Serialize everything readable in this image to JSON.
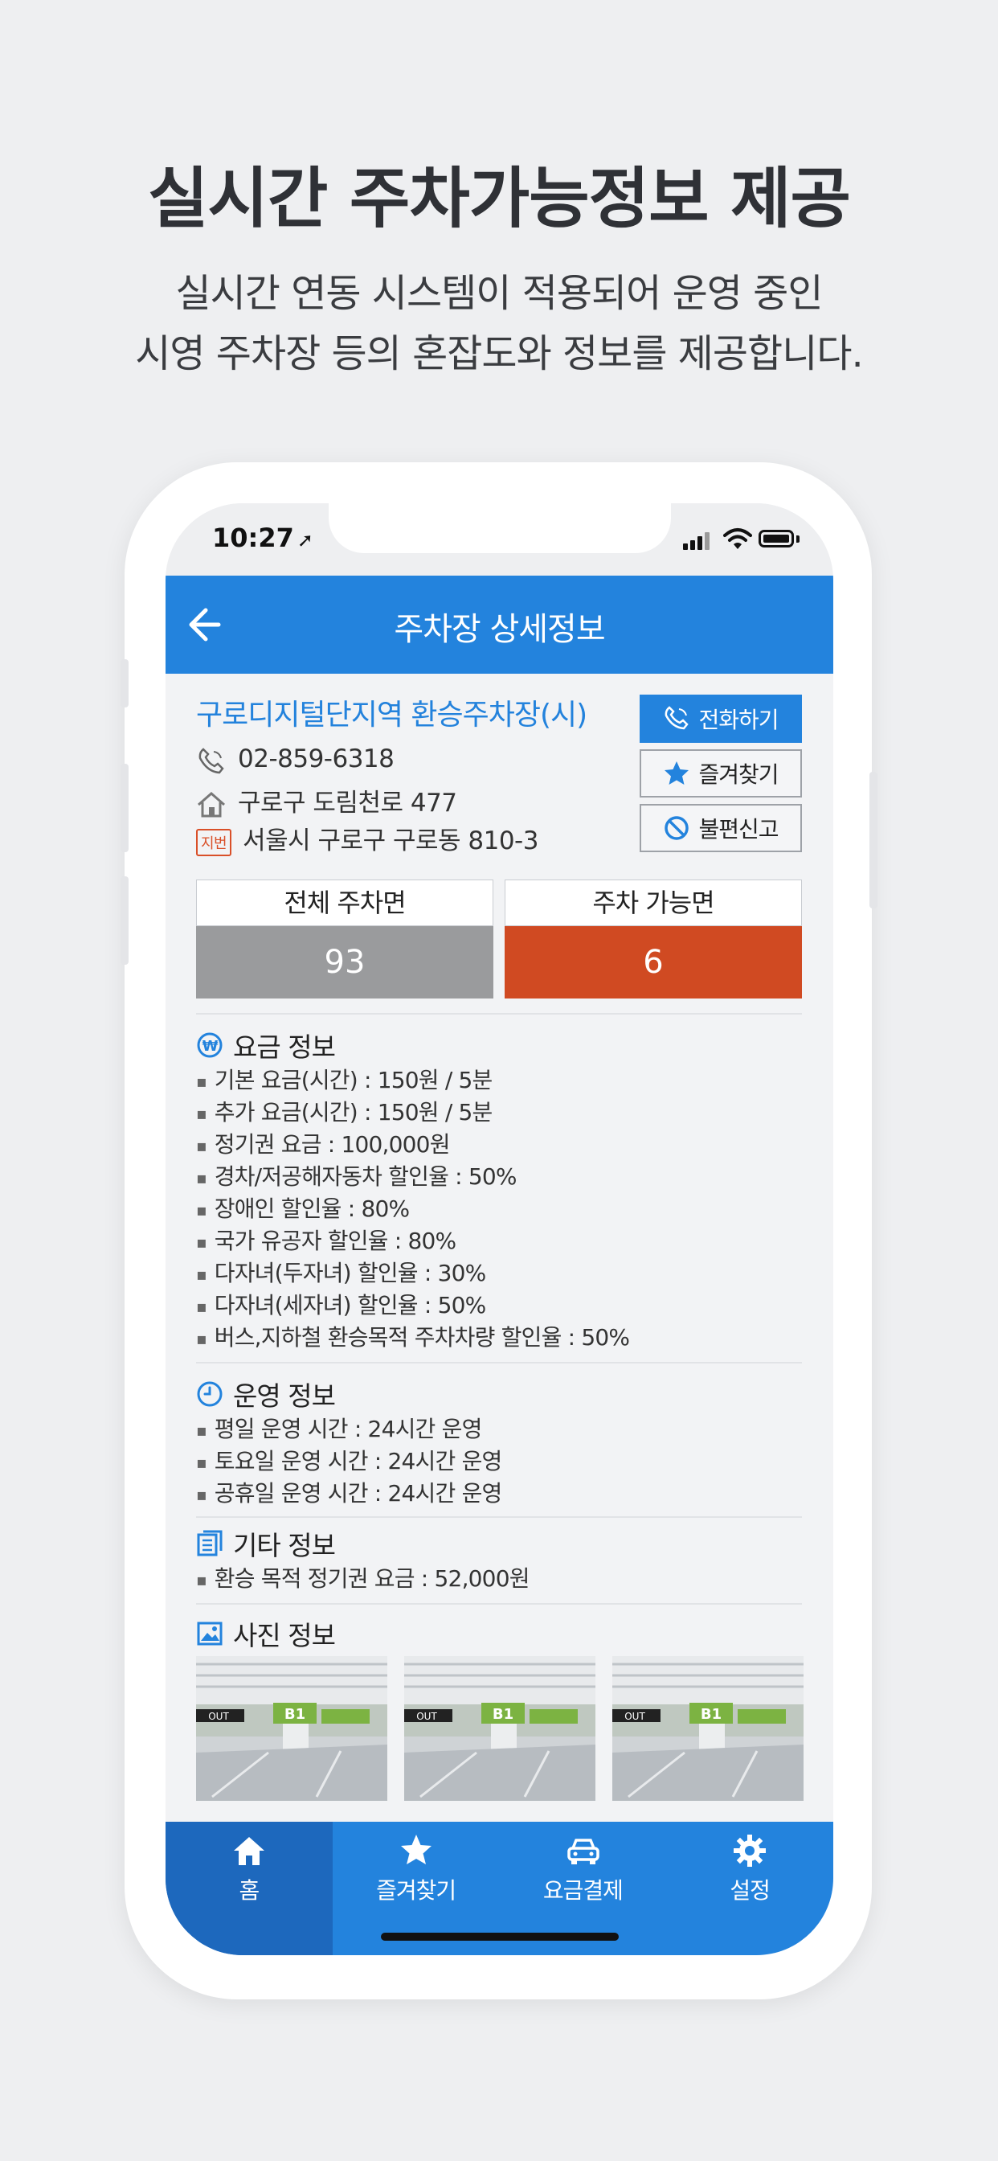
{
  "promo": {
    "headline": "실시간 주차가능정보 제공",
    "subline1": "실시간 연동 시스템이 적용되어 운영 중인",
    "subline2": "시영 주차장 등의 혼잡도와 정보를 제공합니다."
  },
  "status_bar": {
    "time": "10:27",
    "location_icon": "location-arrow-icon"
  },
  "appbar": {
    "title": "주차장 상세정보",
    "back_icon": "back-arrow-icon"
  },
  "lot": {
    "name": "구로디지털단지역 환승주차장(시)",
    "phone": "02-859-6318",
    "road_address": "구로구 도림천로 477",
    "jibun_badge": "지번",
    "jibun_address": "서울시 구로구 구로동 810-3"
  },
  "actions": {
    "call": "전화하기",
    "favorite": "즐겨찾기",
    "report": "불편신고"
  },
  "stats": {
    "total_label": "전체 주차면",
    "total_value": "93",
    "available_label": "주차 가능면",
    "available_value": "6",
    "colors": {
      "total": "#9a9b9d",
      "available": "#d04a22"
    }
  },
  "fee_info": {
    "title": "요금 정보",
    "items": [
      "기본 요금(시간) : 150원 / 5분",
      "추가 요금(시간) : 150원 / 5분",
      "정기권 요금 : 100,000원",
      "경차/저공해자동차 할인율 : 50%",
      "장애인 할인율 : 80%",
      "국가 유공자 할인율 : 80%",
      "다자녀(두자녀) 할인율 : 30%",
      "다자녀(세자녀) 할인율 : 50%",
      "버스,지하철 환승목적 주차차량 할인율 : 50%"
    ]
  },
  "operation_info": {
    "title": "운영 정보",
    "items": [
      "평일 운영 시간 : 24시간 운영",
      "토요일 운영 시간 : 24시간 운영",
      "공휴일 운영 시간 : 24시간 운영"
    ]
  },
  "other_info": {
    "title": "기타 정보",
    "items": [
      "환승 목적 정기권 요금 : 52,000원"
    ]
  },
  "photo_info": {
    "title": "사진 정보",
    "photos": [
      "parking-garage-photo",
      "parking-garage-photo",
      "parking-garage-photo"
    ]
  },
  "tabs": [
    {
      "label": "홈",
      "icon": "home-icon",
      "active": true
    },
    {
      "label": "즐겨찾기",
      "icon": "star-icon",
      "active": false
    },
    {
      "label": "요금결제",
      "icon": "car-icon",
      "active": false
    },
    {
      "label": "설정",
      "icon": "gear-icon",
      "active": false
    }
  ],
  "colors": {
    "accent": "#2383dd",
    "accent_dark": "#1d68bd",
    "background": "#eeeff1"
  }
}
